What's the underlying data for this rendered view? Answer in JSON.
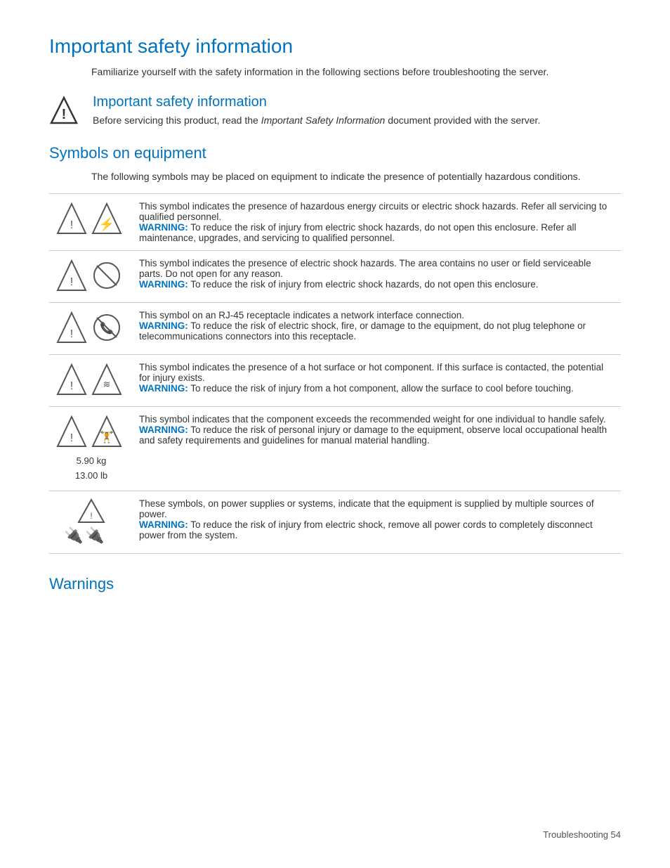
{
  "page": {
    "main_title": "Important safety information",
    "intro": "Familiarize yourself with the safety information in the following sections before troubleshooting the server.",
    "notice_title": "Important safety information",
    "notice_body_prefix": "Before servicing this product, read the ",
    "notice_italic": "Important Safety Information",
    "notice_body_suffix": " document provided with the server.",
    "symbols_title": "Symbols on equipment",
    "symbols_intro": "The following symbols may be placed on equipment to indicate the presence of potentially hazardous conditions.",
    "symbols": [
      {
        "description": "This symbol indicates the presence of hazardous energy circuits or electric shock hazards. Refer all servicing to qualified personnel.",
        "warning": "WARNING:",
        "warning_text": " To reduce the risk of injury from electric shock hazards, do not open this enclosure. Refer all maintenance, upgrades, and servicing to qualified personnel.",
        "type": "lightning"
      },
      {
        "description": "This symbol indicates the presence of electric shock hazards. The area contains no user or field serviceable parts. Do not open for any reason.",
        "warning": "WARNING:",
        "warning_text": " To reduce the risk of injury from electric shock hazards, do not open this enclosure.",
        "type": "no-entry"
      },
      {
        "description": "This symbol on an RJ-45 receptacle indicates a network interface connection.",
        "warning": "WARNING:",
        "warning_text": " To reduce the risk of electric shock, fire, or damage to the equipment, do not plug telephone or telecommunications connectors into this receptacle.",
        "type": "phone"
      },
      {
        "description": "This symbol indicates the presence of a hot surface or hot component. If this surface is contacted, the potential for injury exists.",
        "warning": "WARNING:",
        "warning_text": " To reduce the risk of injury from a hot component, allow the surface to cool before touching.",
        "type": "hot"
      },
      {
        "description": "This symbol indicates that the component exceeds the recommended weight for one individual to handle safely.",
        "warning": "WARNING:",
        "warning_text": " To reduce the risk of personal injury or damage to the equipment, observe local occupational health and safety requirements and guidelines for manual material handling.",
        "type": "weight",
        "weight_kg": "5.90 kg",
        "weight_lb": "13.00 lb"
      },
      {
        "description": "These symbols, on power supplies or systems, indicate that the equipment is supplied by multiple sources of power.",
        "warning": "WARNING:",
        "warning_text": " To reduce the risk of injury from electric shock, remove all power cords to completely disconnect power from the system.",
        "type": "multi-power"
      }
    ],
    "warnings_title": "Warnings",
    "footer": "Troubleshooting    54"
  }
}
